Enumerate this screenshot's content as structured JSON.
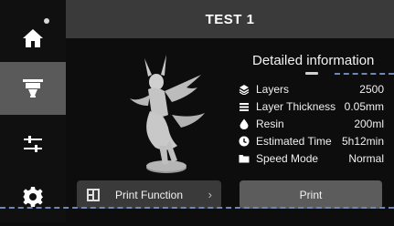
{
  "header": {
    "title": "TEST 1"
  },
  "sidebar": {
    "items": [
      {
        "name": "home"
      },
      {
        "name": "print-files"
      },
      {
        "name": "settings-controls"
      },
      {
        "name": "system-settings"
      }
    ]
  },
  "details": {
    "title": "Detailed information",
    "rows": [
      {
        "label": "Layers",
        "value": "2500",
        "icon": "layers-icon"
      },
      {
        "label": "Layer Thickness",
        "value": "0.05mm",
        "icon": "thickness-icon"
      },
      {
        "label": "Resin",
        "value": "200ml",
        "icon": "resin-drop-icon"
      },
      {
        "label": "Estimated Time",
        "value": "5h12min",
        "icon": "clock-icon"
      },
      {
        "label": "Speed Mode",
        "value": "Normal",
        "icon": "folder-icon"
      }
    ]
  },
  "actions": {
    "print_function_label": "Print Function",
    "print_label": "Print"
  },
  "colors": {
    "sidebar_active": "#5a5a5a",
    "title_bar": "#3a3a3a",
    "print_button": "#5c5c5c",
    "dashed_guide": "#6d87b6"
  }
}
